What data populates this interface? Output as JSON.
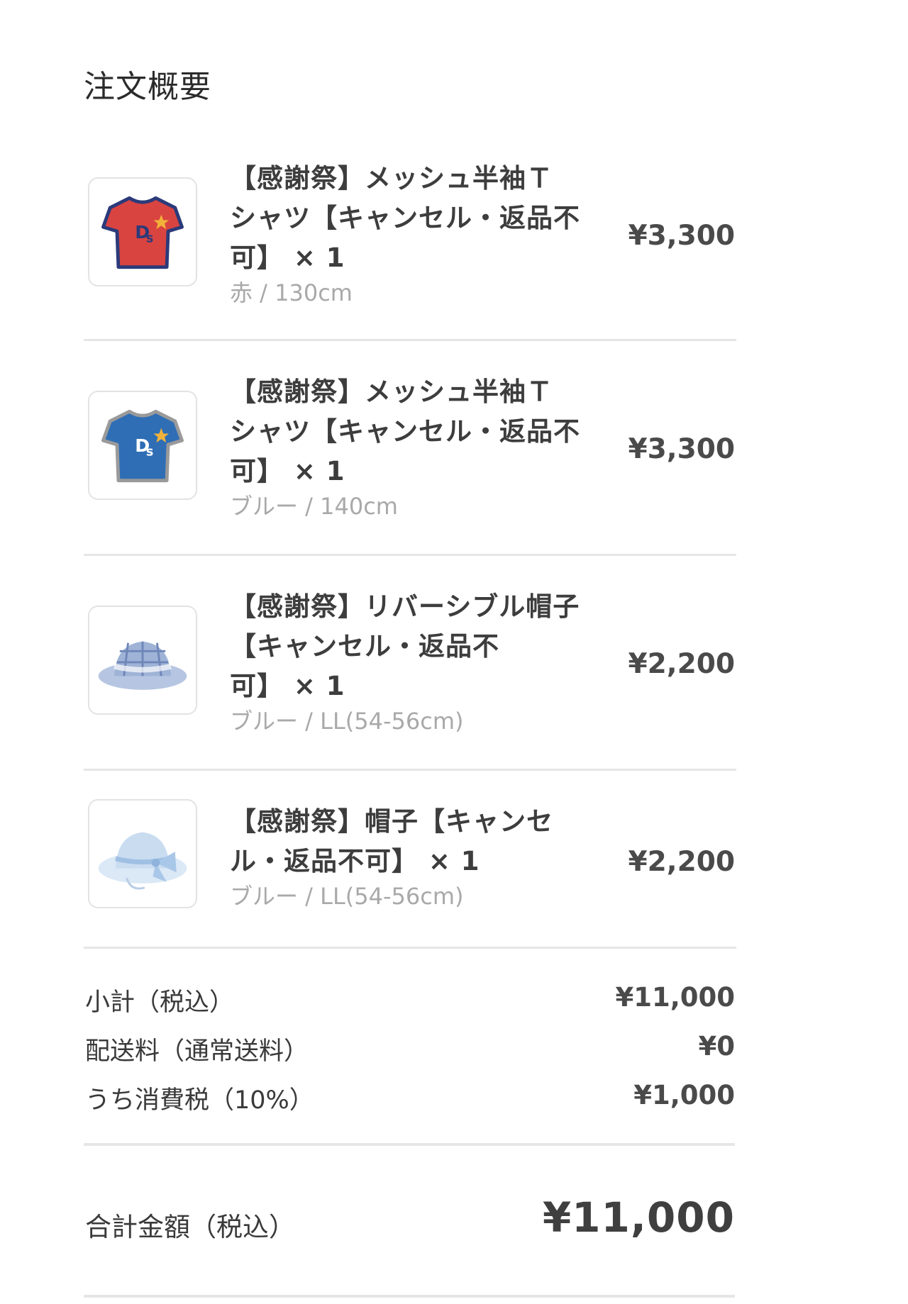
{
  "header": {
    "title": "注文概要"
  },
  "items": [
    {
      "name_lines": [
        "【感謝祭】メッシュ半袖Ｔ",
        "シャツ【キャンセル・返品不",
        "可】 × 1"
      ],
      "variant": "赤 / 130cm",
      "price": "¥3,300",
      "image": "red-tshirt",
      "color": "#d94441"
    },
    {
      "name_lines": [
        "【感謝祭】メッシュ半袖Ｔ",
        "シャツ【キャンセル・返品不",
        "可】 × 1"
      ],
      "variant": "ブルー / 140cm",
      "price": "¥3,300",
      "image": "blue-tshirt",
      "color": "#2f6eb5"
    },
    {
      "name_lines": [
        "【感謝祭】リバーシブル帽子",
        "【キャンセル・返品不",
        "可】 × 1"
      ],
      "variant": "ブルー / LL(54-56cm)",
      "price": "¥2,200",
      "image": "plaid-bucket-hat",
      "color": "#9eb3d6"
    },
    {
      "name_lines": [
        "【感謝祭】帽子【キャンセ",
        "ル・返品不可】 × 1"
      ],
      "variant": "ブルー / LL(54-56cm)",
      "price": "¥2,200",
      "image": "ribbon-bucket-hat",
      "color": "#c9dcf0"
    }
  ],
  "summary": {
    "subtotal_label": "小計（税込）",
    "subtotal_value": "¥11,000",
    "shipping_label": "配送料（通常送料）",
    "shipping_value": "¥0",
    "tax_label": "うち消費税（10%）",
    "tax_value": "¥1,000"
  },
  "total": {
    "label": "合計金額（税込）",
    "value": "¥11,000"
  }
}
